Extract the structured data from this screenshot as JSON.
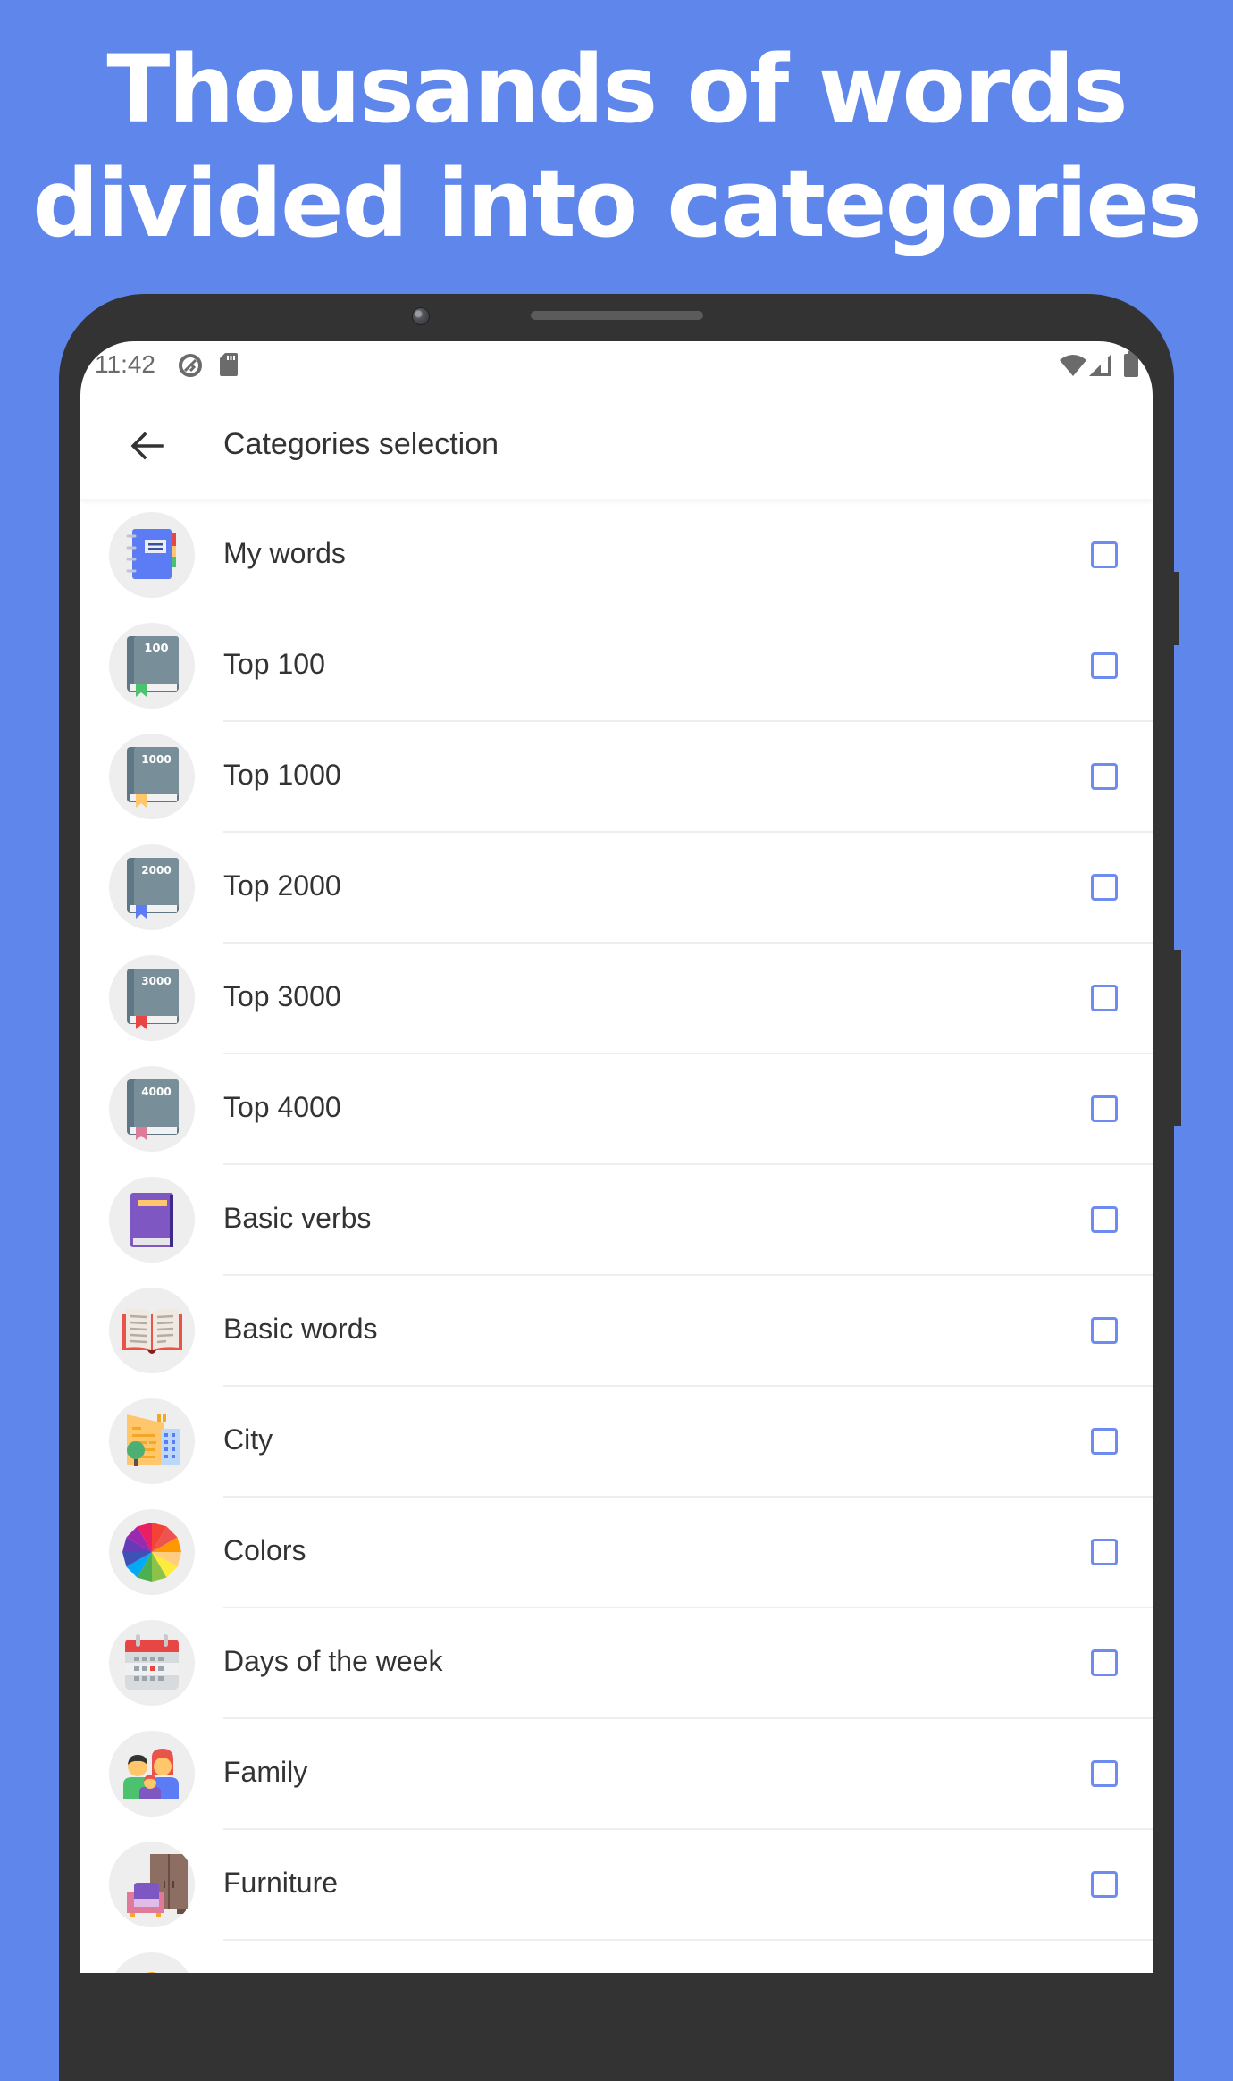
{
  "headline": {
    "line1": "Thousands of words",
    "line2": "divided into categories"
  },
  "status_bar": {
    "time": "11:42",
    "left_icons": [
      "data-saver-icon",
      "sd-card-icon"
    ],
    "right_icons": [
      "wifi-icon",
      "cell-signal-icon",
      "battery-icon"
    ]
  },
  "app_bar": {
    "back_icon": "arrow-left-icon",
    "title": "Categories selection"
  },
  "colors": {
    "background": "#5E86EB",
    "checkbox": "#6E8BF0",
    "text": "#333333"
  },
  "categories": [
    {
      "label": "My words",
      "icon": "notebook-icon",
      "checked": false
    },
    {
      "label": "Top 100",
      "icon": "book-icon",
      "badge": "100",
      "bookmark": "#4CC26E",
      "checked": false
    },
    {
      "label": "Top 1000",
      "icon": "book-icon",
      "badge": "1000",
      "bookmark": "#FFC66B",
      "checked": false
    },
    {
      "label": "Top 2000",
      "icon": "book-icon",
      "badge": "2000",
      "bookmark": "#5B7CF5",
      "checked": false
    },
    {
      "label": "Top 3000",
      "icon": "book-icon",
      "badge": "3000",
      "bookmark": "#E84545",
      "checked": false
    },
    {
      "label": "Top 4000",
      "icon": "book-icon",
      "badge": "4000",
      "bookmark": "#E07A9A",
      "checked": false
    },
    {
      "label": "Basic verbs",
      "icon": "purple-book-icon",
      "checked": false
    },
    {
      "label": "Basic words",
      "icon": "open-book-icon",
      "checked": false
    },
    {
      "label": "City",
      "icon": "city-buildings-icon",
      "checked": false
    },
    {
      "label": "Colors",
      "icon": "color-wheel-icon",
      "checked": false
    },
    {
      "label": "Days of the week",
      "icon": "calendar-icon",
      "checked": false
    },
    {
      "label": "Family",
      "icon": "family-icon",
      "checked": false
    },
    {
      "label": "Furniture",
      "icon": "furniture-icon",
      "checked": false
    },
    {
      "label": "",
      "icon": "partial-orange-icon",
      "checked": false
    }
  ]
}
